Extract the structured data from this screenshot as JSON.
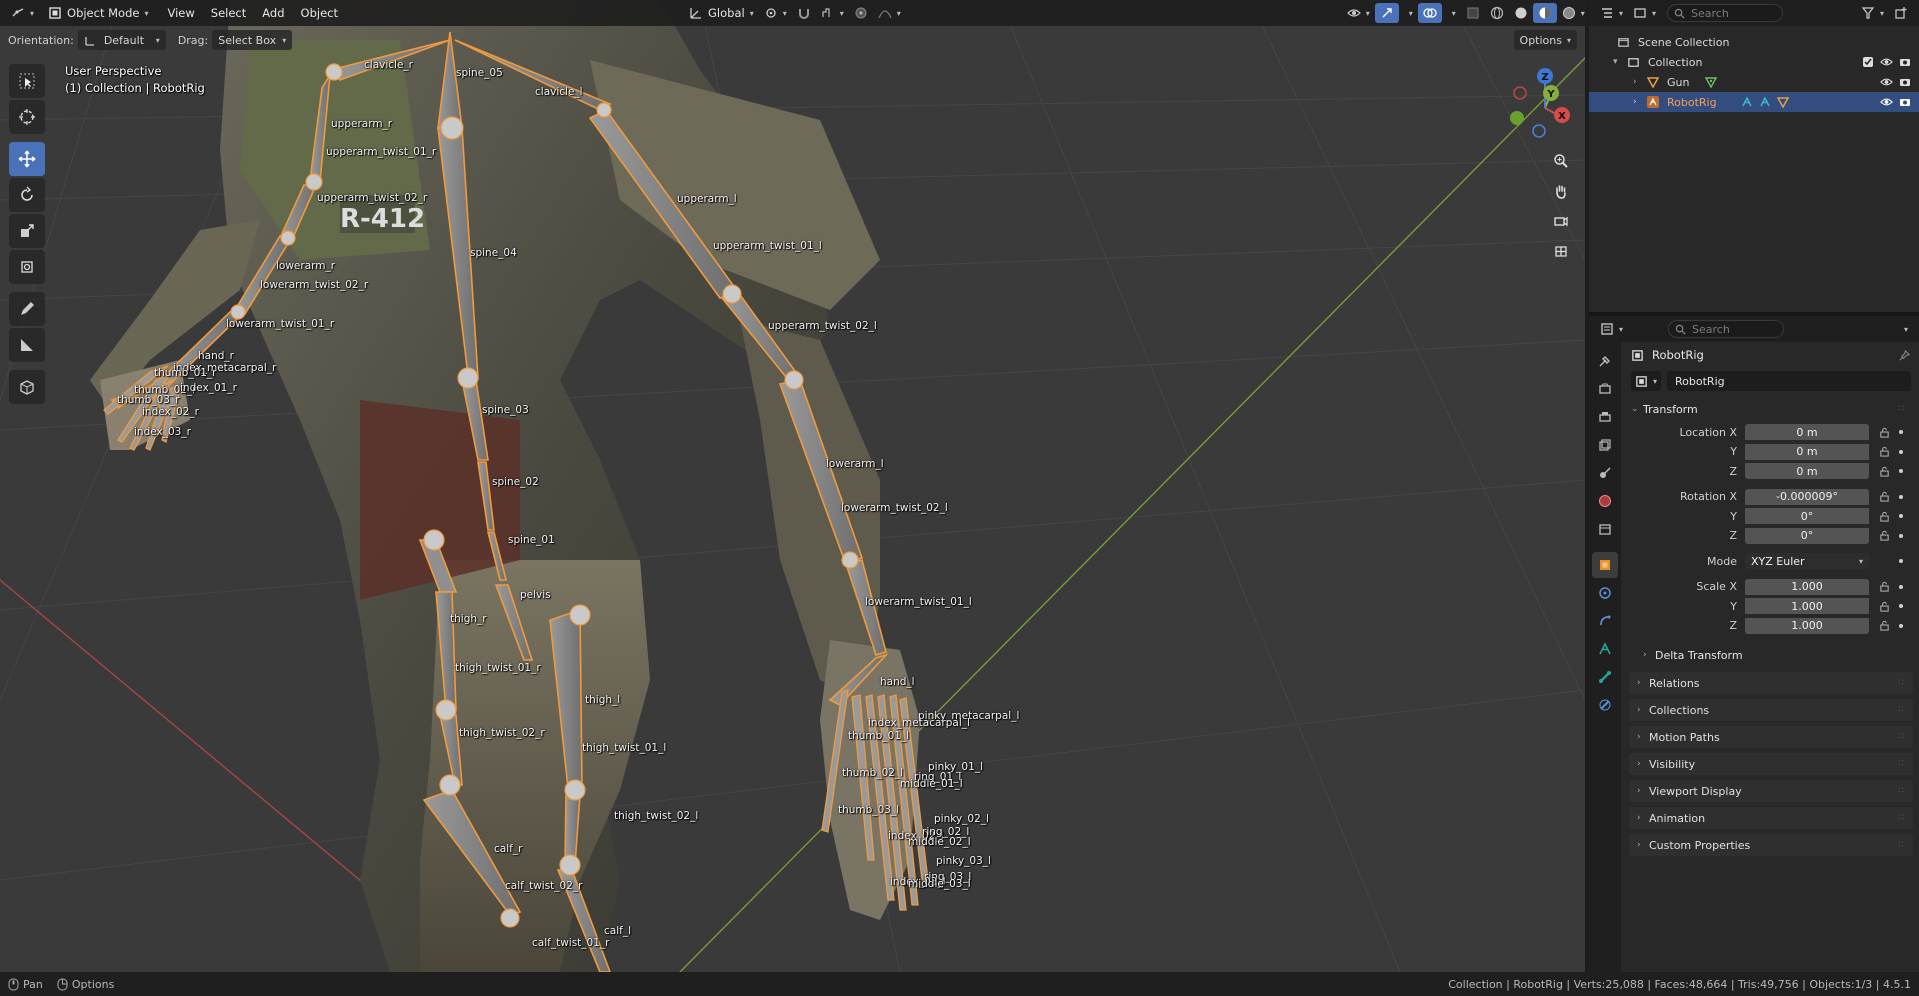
{
  "header": {
    "mode": "Object Mode",
    "menus": [
      "View",
      "Select",
      "Add",
      "Object"
    ],
    "transform_orientation": "Global"
  },
  "tool_settings": {
    "orientation_label": "Orientation:",
    "orientation_value": "Default",
    "drag_label": "Drag:",
    "drag_value": "Select Box",
    "options": "Options"
  },
  "viewport": {
    "view_name": "User Perspective",
    "collection_info": "(1) Collection | RobotRig",
    "decal_text": "R-412",
    "gizmo_axes": {
      "x": "X",
      "y": "Y",
      "z": "Z"
    }
  },
  "bone_labels": [
    "clavicle_r",
    "spine_05",
    "clavicle_l",
    "upperarm_r",
    "upperarm_twist_01_r",
    "upperarm_twist_02_r",
    "upperarm_l",
    "spine_04",
    "upperarm_twist_01_l",
    "lowerarm_r",
    "lowerarm_twist_02_r",
    "upperarm_twist_02_l",
    "lowerarm_twist_01_r",
    "hand_r",
    "index_metacarpal_r",
    "thumb_01_r",
    "thumb_02_r",
    "thumb_03_r",
    "index_01_r",
    "index_02_r",
    "index_03_r",
    "spine_03",
    "lowerarm_l",
    "spine_02",
    "lowerarm_twist_02_l",
    "spine_01",
    "pelvis",
    "lowerarm_twist_01_l",
    "thigh_r",
    "thigh_twist_01_r",
    "hand_l",
    "thigh_l",
    "pinky_metacarpal_l",
    "index_metacarpal_l",
    "thumb_01_l",
    "thigh_twist_02_r",
    "thigh_twist_01_l",
    "pinky_01_l",
    "ring_01_l",
    "thumb_02_l",
    "middle_01_l",
    "thigh_twist_02_l",
    "thumb_03_l",
    "pinky_02_l",
    "index_02_l",
    "ring_02_l",
    "middle_02_l",
    "calf_r",
    "pinky_03_l",
    "ring_03_l",
    "index_03_l",
    "middle_03_l",
    "calf_twist_02_r",
    "calf_l",
    "calf_twist_01_r"
  ],
  "outliner": {
    "search_placeholder": "Search",
    "scene_collection": "Scene Collection",
    "collection": "Collection",
    "items": [
      "Gun",
      "RobotRig"
    ]
  },
  "properties": {
    "search_placeholder": "Search",
    "object_name": "RobotRig",
    "data_name": "RobotRig",
    "transform_title": "Transform",
    "location_label": "Location X",
    "location": [
      "0 m",
      "0 m",
      "0 m"
    ],
    "rotation_label": "Rotation X",
    "rotation": [
      "-0.000009°",
      "0°",
      "0°"
    ],
    "axis_y": "Y",
    "axis_z": "Z",
    "mode_label": "Mode",
    "mode_value": "XYZ Euler",
    "scale_label": "Scale X",
    "scale": [
      "1.000",
      "1.000",
      "1.000"
    ],
    "delta_transform": "Delta Transform",
    "panels": [
      "Relations",
      "Collections",
      "Motion Paths",
      "Visibility",
      "Viewport Display",
      "Animation",
      "Custom Properties"
    ]
  },
  "statusbar": {
    "pan": "Pan",
    "options": "Options",
    "stats": "Collection | RobotRig | Verts:25,088 | Faces:48,664 | Tris:49,756 | Objects:1/3 | 4.5.1"
  },
  "colors": {
    "accent": "#4a72b8",
    "selection": "#334d80",
    "bone_outline": "#f09a3e",
    "bone_fill": "#8a8a8a",
    "grid": "#454545",
    "x_axis": "#b34848",
    "y_axis": "#7fa33a"
  }
}
